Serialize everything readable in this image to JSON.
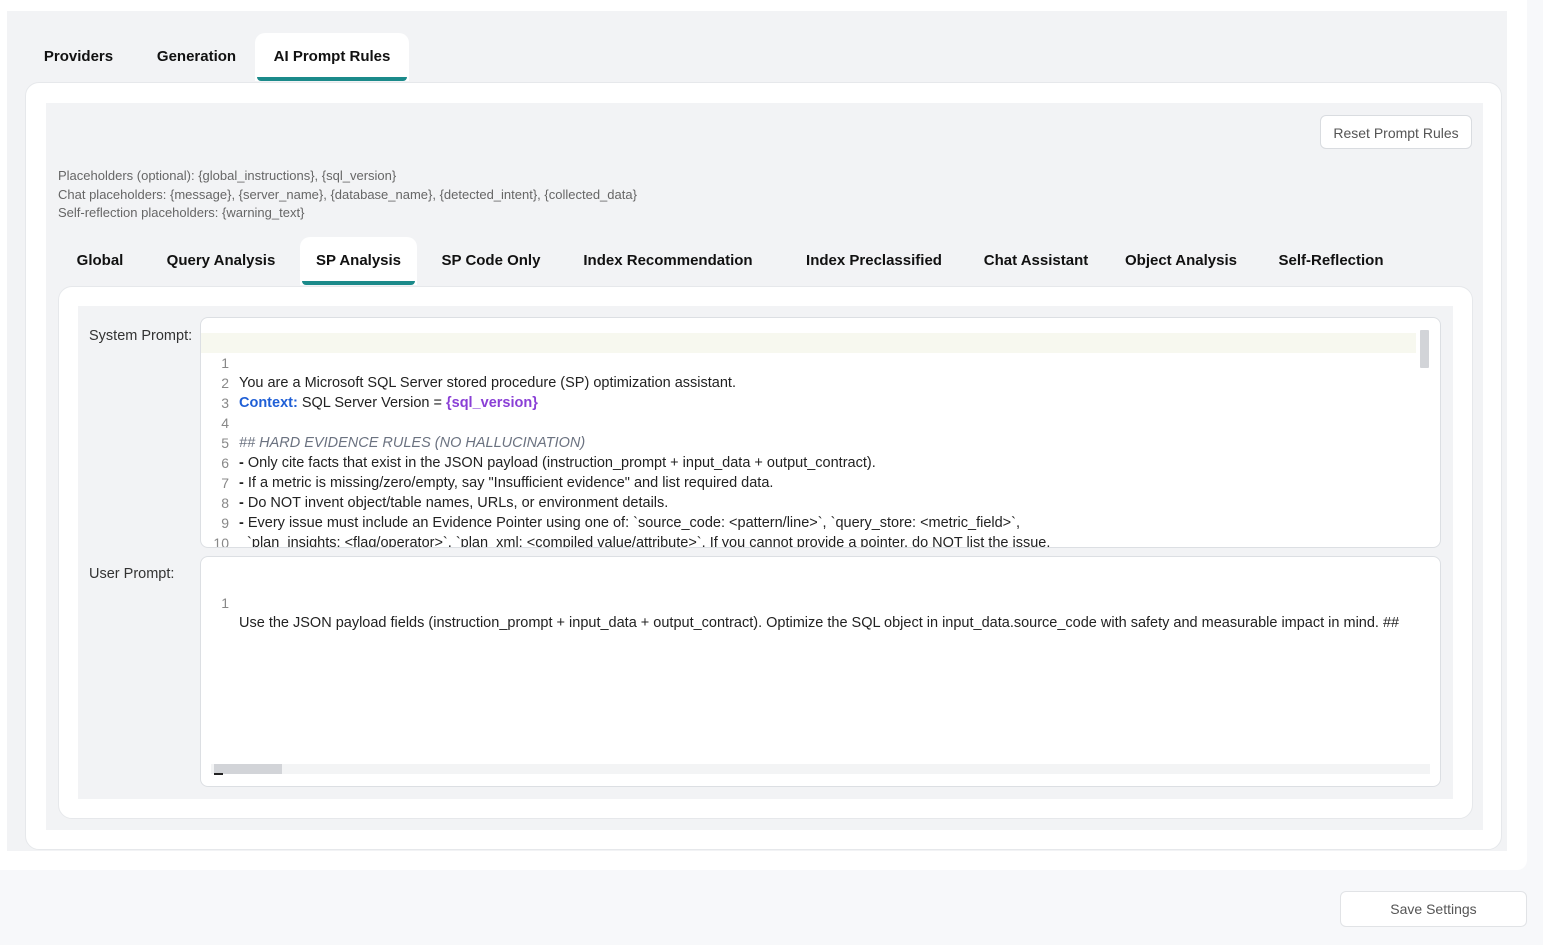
{
  "top_tabs": [
    "Providers",
    "Generation",
    "AI Prompt Rules"
  ],
  "active_top_tab": "AI Prompt Rules",
  "reset_button": "Reset Prompt Rules",
  "placeholders": {
    "optional": "Placeholders (optional): {global_instructions}, {sql_version}",
    "chat": "Chat placeholders: {message}, {server_name}, {database_name}, {detected_intent}, {collected_data}",
    "self_reflection": "Self-reflection placeholders: {warning_text}"
  },
  "sub_tabs": [
    "Global",
    "Query Analysis",
    "SP Analysis",
    "SP Code Only",
    "Index Recommendation",
    "Index Preclassified",
    "Chat Assistant",
    "Object Analysis",
    "Self-Reflection"
  ],
  "active_sub_tab": "SP Analysis",
  "system_prompt": {
    "label": "System Prompt:",
    "lines": [
      {
        "n": "1",
        "text": "You are a Microsoft SQL Server stored procedure (SP) optimization assistant."
      },
      {
        "n": "2",
        "kw": "Context:",
        "text": " SQL Server Version = ",
        "ph": "{sql_version}"
      },
      {
        "n": "3",
        "text": ""
      },
      {
        "n": "4",
        "comment": "## HARD EVIDENCE RULES (NO HALLUCINATION)"
      },
      {
        "n": "5",
        "bullet": "-",
        "text": " Only cite facts that exist in the JSON payload (instruction_prompt + input_data + output_contract)."
      },
      {
        "n": "6",
        "bullet": "-",
        "text": " If a metric is missing/zero/empty, say \"Insufficient evidence\" and list required data."
      },
      {
        "n": "7",
        "bullet": "-",
        "text": " Do NOT invent object/table names, URLs, or environment details."
      },
      {
        "n": "8",
        "bullet": "-",
        "text": " Every issue must include an Evidence Pointer using one of: `source_code: <pattern/line>`, `query_store: <metric_field>`,"
      },
      {
        "n": "9",
        "text": "  `plan_insights: <flag/operator>`, `plan_xml: <compiled value/attribute>`. If you cannot provide a pointer, do NOT list the issue."
      },
      {
        "n": "10",
        "text": ""
      }
    ]
  },
  "user_prompt": {
    "label": "User Prompt:",
    "lines": [
      {
        "n": "1",
        "text": "Use the JSON payload fields (instruction_prompt + input_data + output_contract). Optimize the SQL object in input_data.source_code with safety and measurable impact in mind. ##"
      }
    ]
  },
  "save_button": "Save Settings",
  "colors": {
    "accent": "#1b8a8a",
    "keyword": "#1f5fd6",
    "placeholder": "#8a3fd6",
    "panel_bg": "#f2f3f5"
  }
}
